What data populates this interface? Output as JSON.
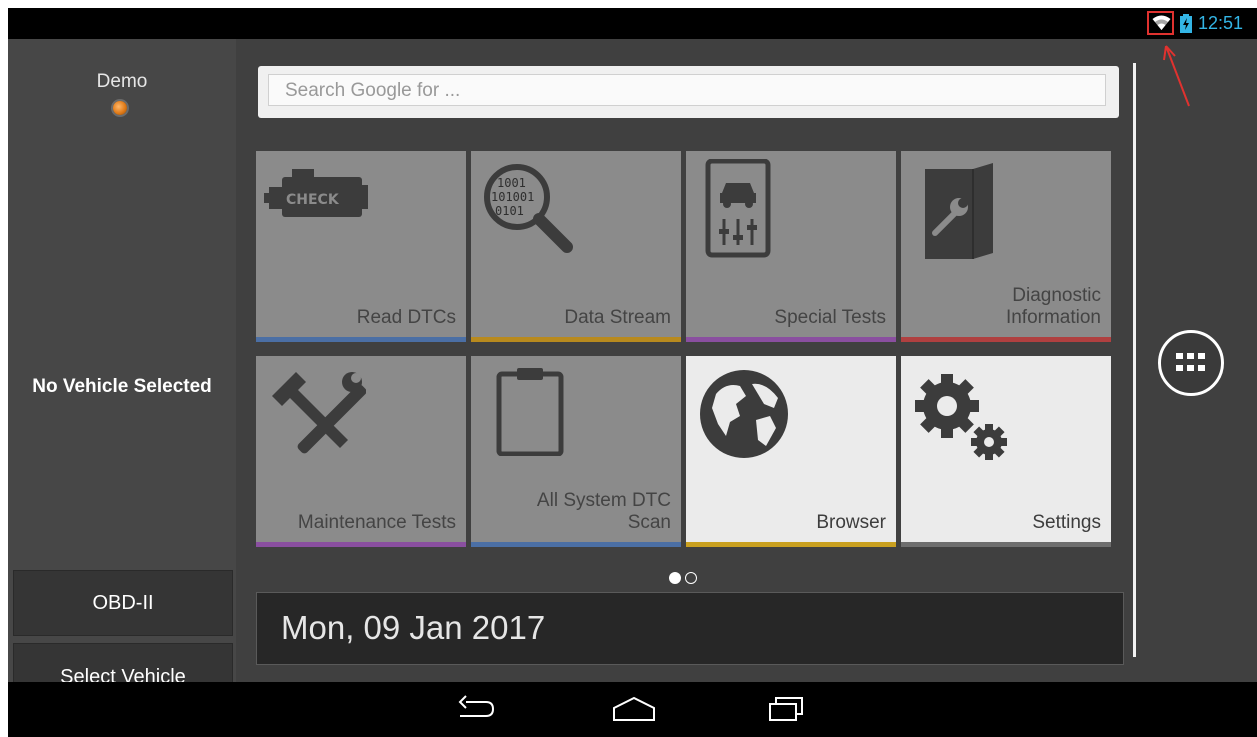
{
  "status_bar": {
    "time": "12:51",
    "wifi_icon": "wifi-icon",
    "battery_icon": "battery-charging-icon",
    "highlight_color": "#e0322f",
    "clock_color": "#33b5e5"
  },
  "left_panel": {
    "mode_label": "Demo",
    "vehicle_status": "No Vehicle Selected",
    "protocol_button": "OBD-II",
    "select_vehicle_button": "Select Vehicle"
  },
  "search": {
    "placeholder": "Search Google for ..."
  },
  "tiles": [
    {
      "label": "Read DTCs",
      "icon": "check-engine-icon",
      "accent": "#4b6fa5"
    },
    {
      "label": "Data Stream",
      "icon": "binary-magnifier-icon",
      "accent": "#b88a1e"
    },
    {
      "label": "Special Tests",
      "icon": "car-adjust-icon",
      "accent": "#8a4fa0"
    },
    {
      "label": "Diagnostic Information",
      "label_line1": "Diagnostic",
      "label_line2": "Information",
      "icon": "wrench-book-icon",
      "accent": "#b04040"
    },
    {
      "label": "Maintenance Tests",
      "icon": "tools-icon",
      "accent": "#8a4fa0"
    },
    {
      "label": "All System DTC Scan",
      "label_line1": "All System DTC",
      "label_line2": "Scan",
      "icon": "clipboard-icon",
      "accent": "#4b6fa5"
    },
    {
      "label": "Browser",
      "icon": "globe-icon",
      "accent": "#c9a020"
    },
    {
      "label": "Settings",
      "icon": "gears-icon",
      "accent": "#6e6e6e"
    }
  ],
  "pager": {
    "current": 1,
    "total": 2
  },
  "date_widget": {
    "date": "Mon, 09 Jan 2017"
  },
  "nav_bar": {
    "back": "back-icon",
    "home": "home-icon",
    "recents": "recents-icon"
  }
}
